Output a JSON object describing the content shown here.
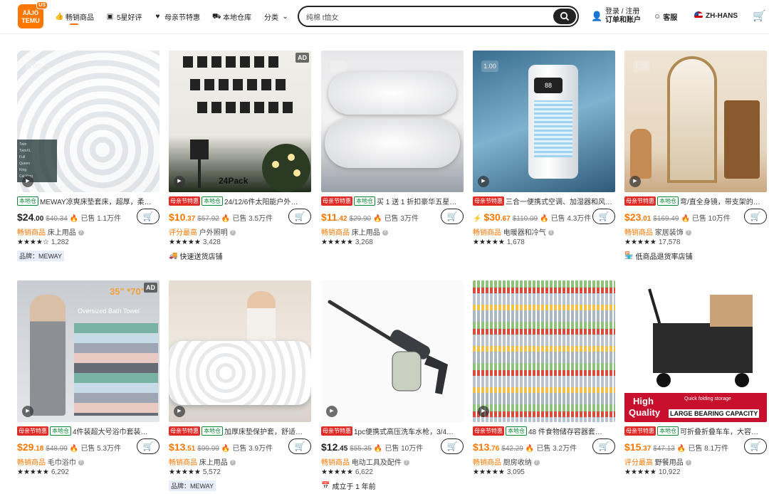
{
  "header": {
    "logo_top": "ÄÃJÖ",
    "logo_text": "TEMU",
    "logo_badge": "US",
    "nav": [
      {
        "label": "畅销商品",
        "icon": "thumbs-up-icon"
      },
      {
        "label": "5星好评",
        "icon": "star-badge-icon"
      },
      {
        "label": "母亲节特惠",
        "icon": "gift-icon"
      },
      {
        "label": "本地仓库",
        "icon": "truck-icon"
      },
      {
        "label": "分类",
        "icon": "chevron-down-icon"
      }
    ],
    "search_value": "纯棉 t恤女",
    "login_line1": "登录 / 注册",
    "login_line2": "订单和账户",
    "service": "客服",
    "language": "ZH-HANS"
  },
  "colors": {
    "accent": "#fb7701",
    "red_tag": "#e02b27",
    "green_tag": "#0a8a37"
  },
  "products": [
    {
      "tags": [
        "本地仓"
      ],
      "title": "MEWAY凉爽床垫套床，超厚，柔…",
      "price_int": "24",
      "price_dec": ".00",
      "orig": "$40.34",
      "sold": "已售 1.1万件",
      "orange": false,
      "cat_label": "畅销商品",
      "category": "床上用品",
      "rating": "★★★★☆",
      "reviews": "1,282",
      "extra_icon": "",
      "extra": "品牌：MEWAY",
      "brand": true,
      "ad": false
    },
    {
      "tags": [
        "母亲节特惠",
        "本地仓"
      ],
      "title": "24/12/6件太阳能户外…",
      "price_int": "10",
      "price_dec": ".37",
      "orig": "$57.92",
      "sold": "已售 3.5万件",
      "orange": true,
      "cat_label": "评分最高",
      "category": "户外照明",
      "rating": "★★★★★",
      "reviews": "3,428",
      "extra_icon": "🚚",
      "extra": "快速送货店铺",
      "brand": false,
      "ad": true
    },
    {
      "tags": [
        "母亲节特惠",
        "本地仓"
      ],
      "title": "买 1 送 1 折扣豪华五星…",
      "price_int": "11",
      "price_dec": ".42",
      "orig": "$29.90",
      "sold": "已售 3万件",
      "orange": true,
      "cat_label": "畅销商品",
      "category": "床上用品",
      "rating": "★★★★★",
      "reviews": "3,268",
      "extra_icon": "",
      "extra": "",
      "brand": false,
      "ad": false
    },
    {
      "tags": [
        "母亲节特惠"
      ],
      "title": "三合一便携式空调、加湿器和风…",
      "price_int": "30",
      "price_dec": ".67",
      "orig": "$110.09",
      "sold": "已售 4.3万件",
      "orange": true,
      "cat_label": "畅销商品",
      "category": "电暖器和冷气",
      "rating": "★★★★★",
      "reviews": "1,678",
      "extra_icon": "",
      "extra": "",
      "brand": false,
      "ad": false
    },
    {
      "tags": [
        "母亲节特惠",
        "本地仓"
      ],
      "title": "弯/直全身镜，带支架的…",
      "price_int": "23",
      "price_dec": ".01",
      "orig": "$169.49",
      "sold": "已售 10万件",
      "orange": true,
      "cat_label": "畅销商品",
      "category": "家居装饰",
      "rating": "★★★★★",
      "reviews": "17,578",
      "extra_icon": "🏪",
      "extra": "低商品退货率店铺",
      "brand": false,
      "ad": false
    },
    {
      "tags": [
        "母亲节特惠",
        "本地仓"
      ],
      "title": "4件装超大号浴巾套装…",
      "price_int": "29",
      "price_dec": ".18",
      "orig": "$48.99",
      "sold": "已售 5.3万件",
      "orange": true,
      "cat_label": "畅销商品",
      "category": "毛巾浴巾",
      "rating": "★★★★★",
      "reviews": "6,292",
      "extra_icon": "",
      "extra": "",
      "brand": false,
      "ad": true
    },
    {
      "tags": [
        "母亲节特惠",
        "本地仓"
      ],
      "title": "加厚床垫保护套，舒适…",
      "price_int": "13",
      "price_dec": ".51",
      "orig": "$99.99",
      "sold": "已售 3.9万件",
      "orange": true,
      "cat_label": "畅销商品",
      "category": "床上用品",
      "rating": "★★★★★",
      "reviews": "5,572",
      "extra_icon": "",
      "extra": "品牌：MEWAY",
      "brand": true,
      "ad": false
    },
    {
      "tags": [
        "母亲节特惠"
      ],
      "title": "1pc便携式高压洗车水枪，3/4…",
      "price_int": "12",
      "price_dec": ".45",
      "orig": "$55.35",
      "sold": "已售 10万件",
      "orange": false,
      "cat_label": "畅销商品",
      "category": "电动工具及配件",
      "rating": "★★★★★",
      "reviews": "6,622",
      "extra_icon": "📅",
      "extra": "成立于 1 年前",
      "brand": false,
      "ad": false
    },
    {
      "tags": [
        "母亲节特惠",
        "本地仓"
      ],
      "title": "48 件食物储存容器套…",
      "price_int": "13",
      "price_dec": ".76",
      "orig": "$42.29",
      "sold": "已售 3.2万件",
      "orange": true,
      "cat_label": "畅销商品",
      "category": "厨房收纳",
      "rating": "★★★★★",
      "reviews": "3,095",
      "extra_icon": "",
      "extra": "",
      "brand": false,
      "ad": false
    },
    {
      "tags": [
        "母亲节特惠",
        "本地仓"
      ],
      "title": "可折叠折叠车车，大容…",
      "price_int": "15",
      "price_dec": ".37",
      "orig": "$47.13",
      "sold": "已售 8.1万件",
      "orange": true,
      "cat_label": "评分最高",
      "category": "野餐用品",
      "rating": "★★★★★",
      "reviews": "10,922",
      "extra_icon": "",
      "extra": "",
      "brand": false,
      "ad": false
    }
  ],
  "image_texts": {
    "p2_pack": "24Pack",
    "p5_size": "35\" *70\"",
    "p5_sub": "Oversized Bath Towel",
    "p9_t1": "High",
    "p9_t2": "Quality",
    "p9_t3": "LARGE BEARING CAPACITY",
    "p9_t4": "Quick folding storage"
  }
}
